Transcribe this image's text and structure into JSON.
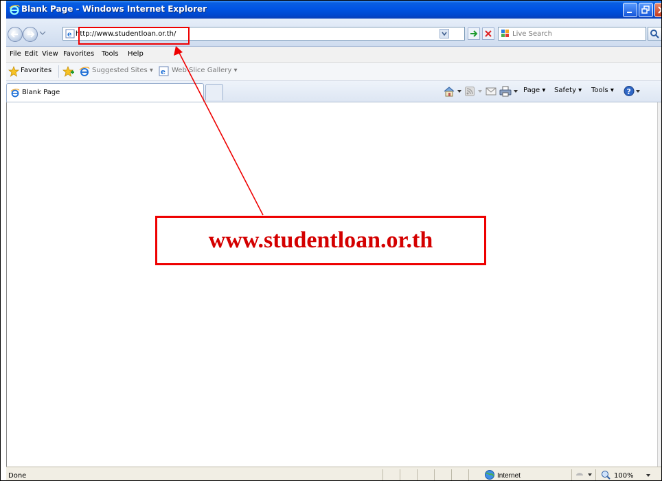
{
  "window": {
    "title": "Blank Page - Windows Internet Explorer"
  },
  "address_bar": {
    "url": "http://www.studentloan.or.th/"
  },
  "search": {
    "placeholder": "Live Search"
  },
  "menu": [
    "File",
    "Edit",
    "View",
    "Favorites",
    "Tools",
    "Help"
  ],
  "favorites_bar": {
    "favorites_label": "Favorites",
    "suggested_sites": "Suggested Sites ▾",
    "web_slice_gallery": "Web Slice Gallery ▾"
  },
  "tab": {
    "label": "Blank Page"
  },
  "command_bar": {
    "page": "Page ▾",
    "safety": "Safety ▾",
    "tools": "Tools ▾"
  },
  "annotation": {
    "text": "www.studentloan.or.th",
    "color": "#e00000"
  },
  "status_bar": {
    "status": "Done",
    "zone": "Internet",
    "zoom": "100%"
  }
}
